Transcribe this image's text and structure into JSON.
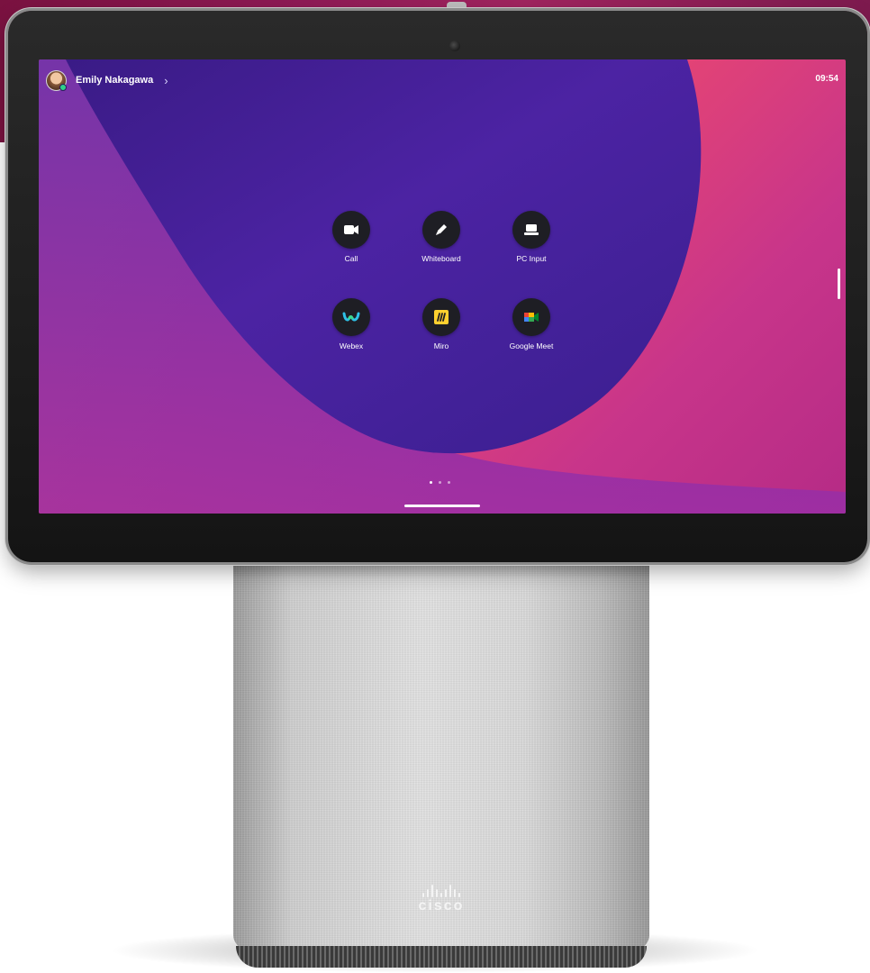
{
  "header": {
    "user_name": "Emily Nakagawa",
    "time": "09:54"
  },
  "apps": [
    {
      "label": "Call",
      "icon": "video-camera-icon"
    },
    {
      "label": "Whiteboard",
      "icon": "pencil-icon"
    },
    {
      "label": "PC Input",
      "icon": "laptop-icon"
    },
    {
      "label": "Webex",
      "icon": "webex-logo-icon"
    },
    {
      "label": "Miro",
      "icon": "miro-logo-icon"
    },
    {
      "label": "Google Meet",
      "icon": "google-meet-logo-icon"
    }
  ],
  "brand": {
    "logo_text": "cisco"
  },
  "colors": {
    "screen_purple": "#4a1f9c",
    "screen_coral": "#ff6a4f",
    "app_circle": "#1e1e24",
    "miro_yellow": "#ffd02f"
  }
}
